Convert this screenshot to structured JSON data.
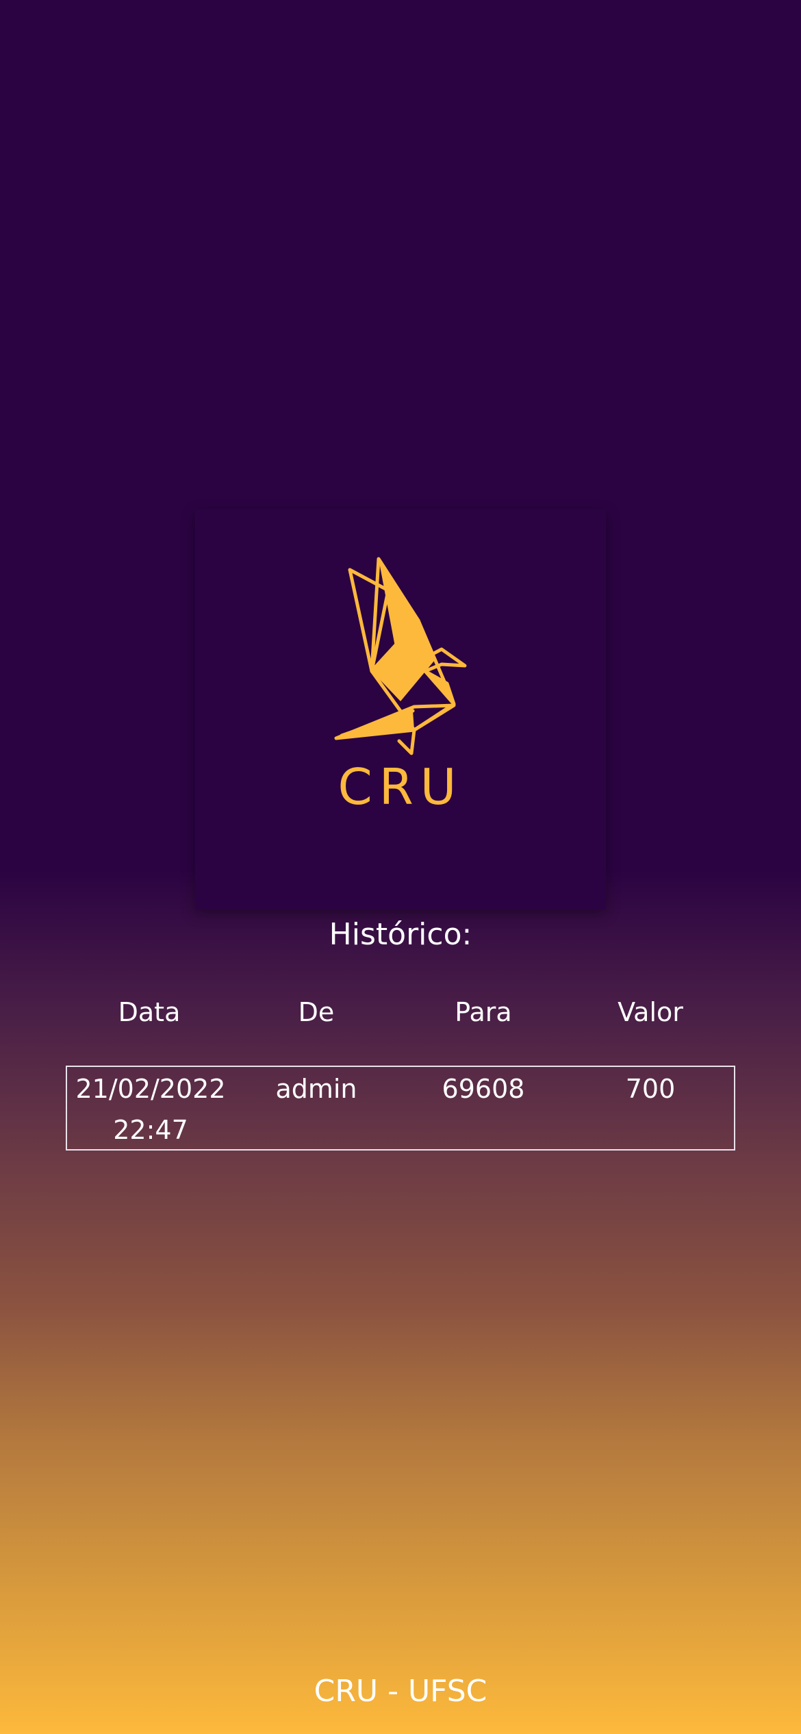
{
  "logo": {
    "icon": "origami-bird-icon",
    "wordmark": "CRU",
    "color": "#fdb93c",
    "card_color": "#2b0342"
  },
  "history": {
    "title": "Histórico:",
    "columns": [
      "Data",
      "De",
      "Para",
      "Valor"
    ],
    "rows": [
      {
        "data": "21/02/2022\n22:47",
        "de": "admin",
        "para": "69608",
        "valor": "700"
      }
    ]
  },
  "footer": {
    "text": "CRU - UFSC"
  },
  "colors": {
    "background_top": "#2b0342",
    "background_bottom": "#fdb93c",
    "text": "#ffffff"
  }
}
